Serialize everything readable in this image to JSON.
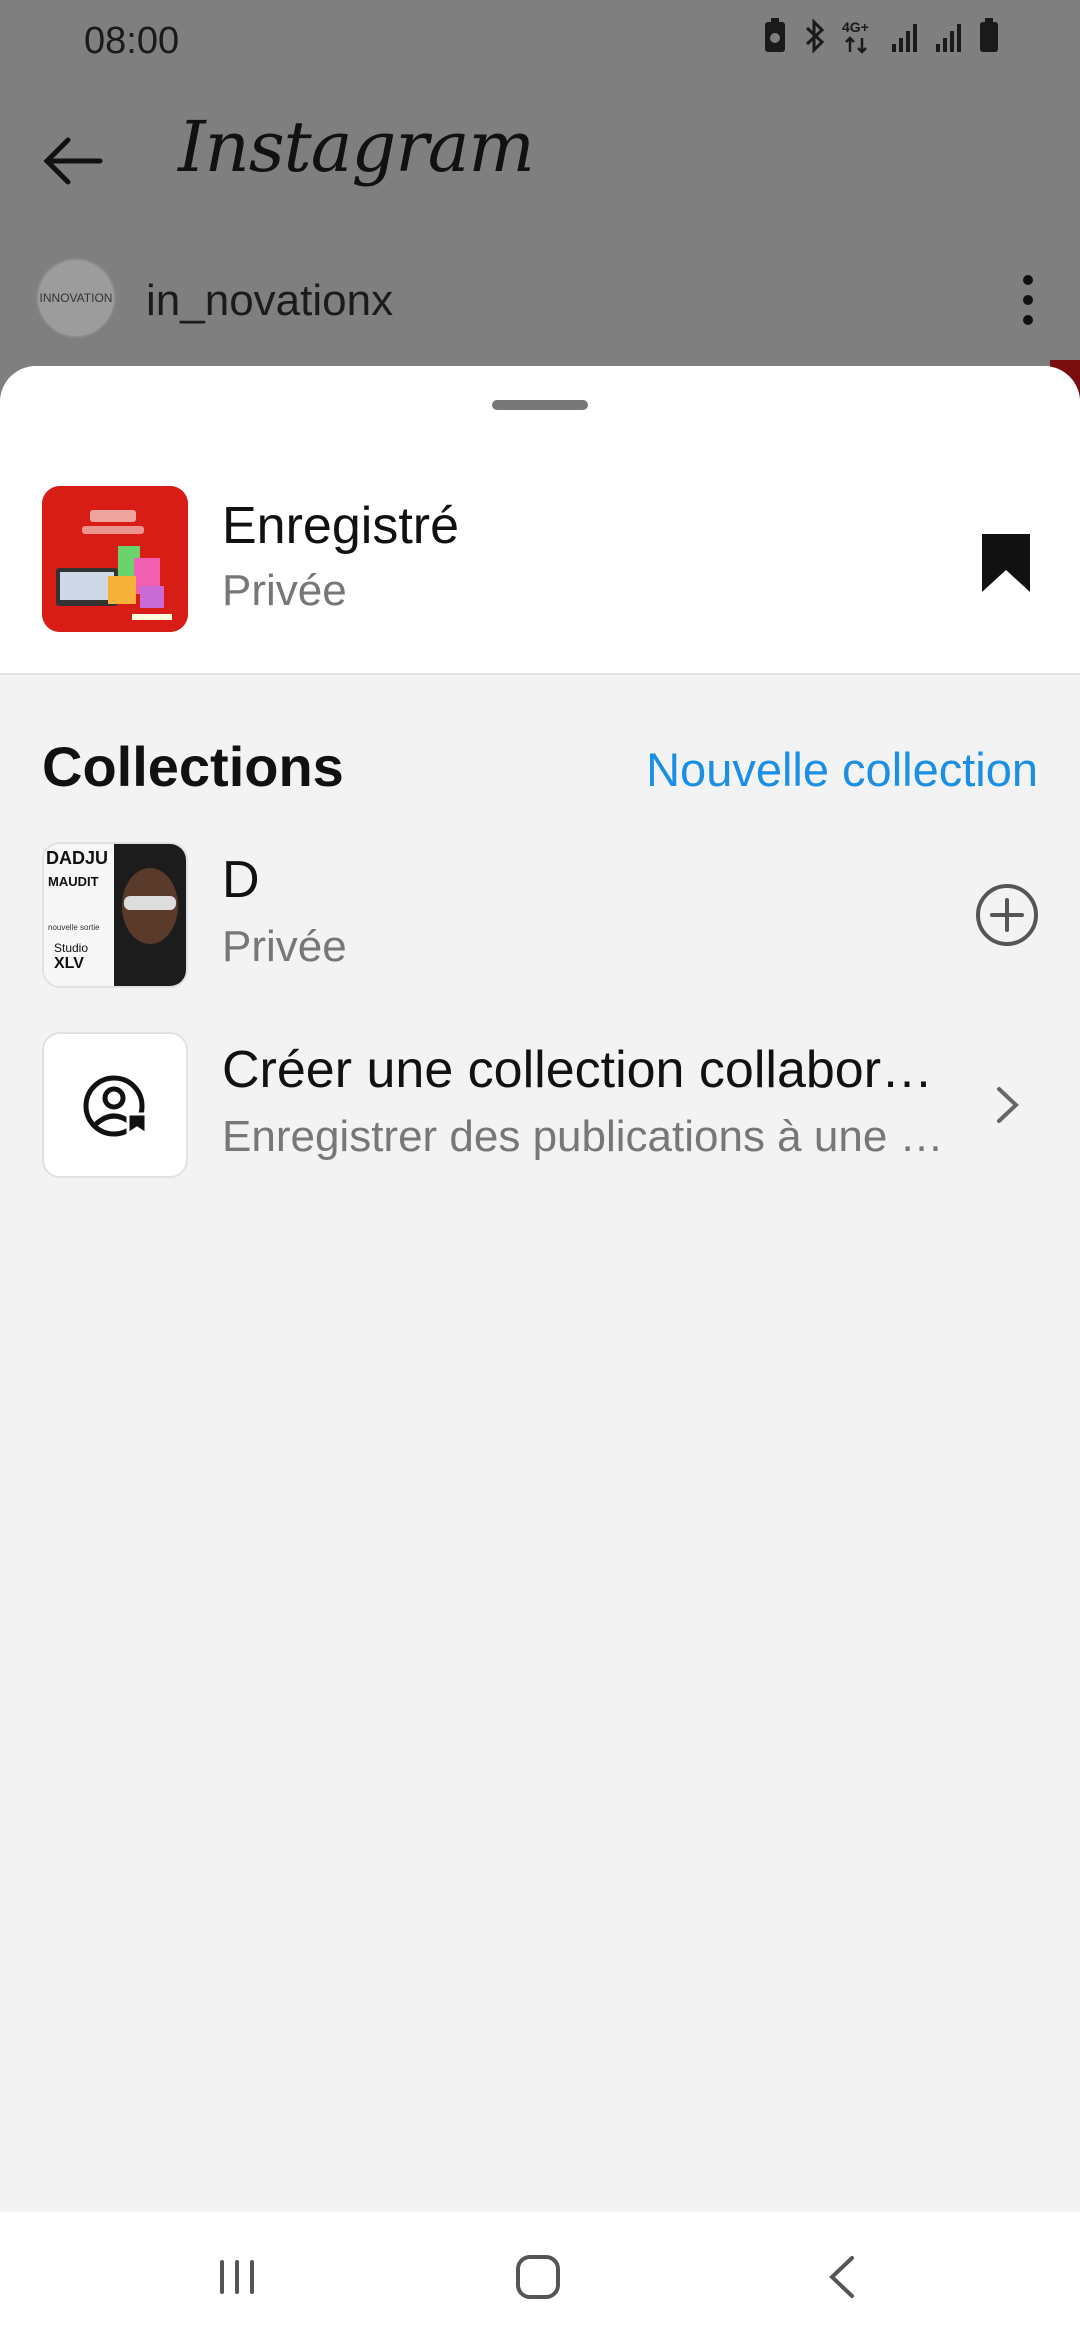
{
  "status_bar": {
    "time": "08:00",
    "network": "4G+"
  },
  "header": {
    "app_name": "Instagram"
  },
  "profile": {
    "username": "in_novationx",
    "avatar_text": "INNOVATION"
  },
  "sheet": {
    "saved": {
      "title": "Enregistré",
      "subtitle": "Privée"
    },
    "collections_title": "Collections",
    "new_collection_label": "Nouvelle collection",
    "items": [
      {
        "title": "D",
        "subtitle": "Privée"
      },
      {
        "title": "Créer une collection collaborative",
        "subtitle": "Enregistrer des publications à une collection partagée"
      }
    ]
  },
  "thumb_texts": {
    "dadju_line1": "DADJU",
    "dadju_line2": "MAUDIT",
    "dadju_line3": "nouvelle sortie",
    "dadju_line4": "Studio",
    "dadju_line5": "XLV"
  },
  "colors": {
    "accent": "#1a8fe3",
    "sheet_bg": "#f3f3f3",
    "overlay": "#7f7f7f"
  }
}
